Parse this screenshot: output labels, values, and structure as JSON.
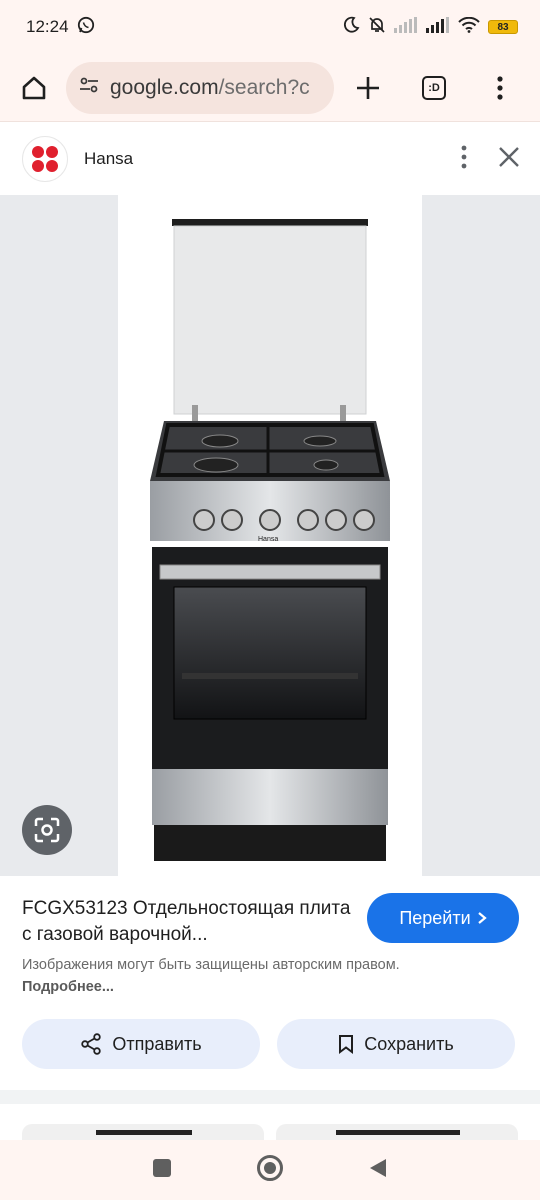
{
  "status_bar": {
    "time": "12:24",
    "battery": "83"
  },
  "browser": {
    "url_domain": "google.com",
    "url_rest": "/search?c",
    "tabs_label": ":D"
  },
  "source": {
    "name": "Hansa"
  },
  "result": {
    "title": "FCGX53123 Отдельностоящая плита с газовой варочной...",
    "visit_label": "Перейти",
    "copyright_text": "Изображения могут быть защищены авторским правом.",
    "more_link": "Подробнее...",
    "share_label": "Отправить",
    "save_label": "Сохранить"
  },
  "image": {
    "panel_text": "Hansa"
  },
  "colors": {
    "accent": "#1a73e8",
    "chrome_bg": "#fff5f2",
    "brand_red": "#e0202e"
  }
}
